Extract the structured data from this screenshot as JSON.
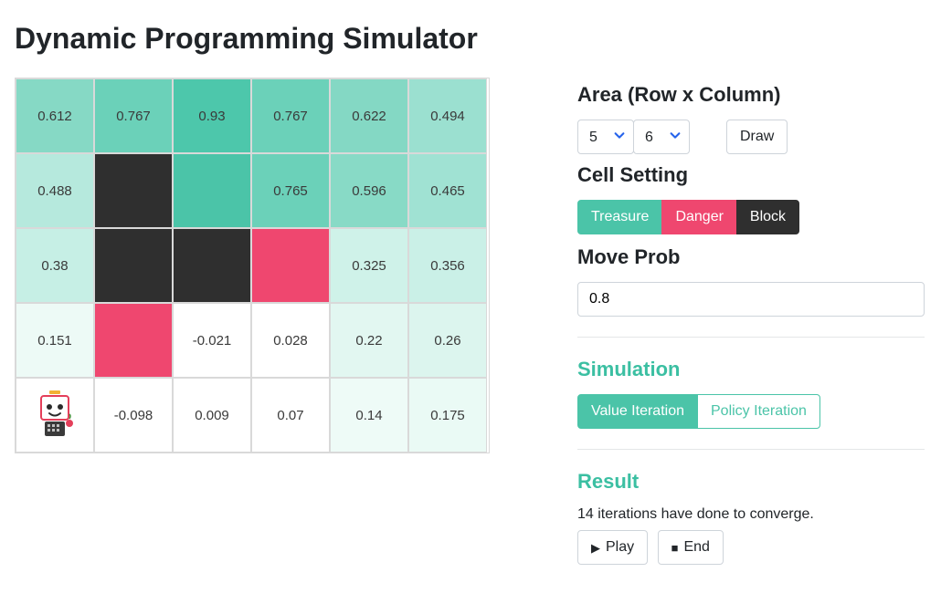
{
  "title": "Dynamic Programming Simulator",
  "grid": {
    "rows": 5,
    "cols": 6,
    "cells": [
      [
        {
          "text": "0.612",
          "bg": "#86d9c5"
        },
        {
          "text": "0.767",
          "bg": "#6bd1b9"
        },
        {
          "text": "0.93",
          "bg": "#4dc7ab"
        },
        {
          "text": "0.767",
          "bg": "#6bd1b9"
        },
        {
          "text": "0.622",
          "bg": "#84d8c4"
        },
        {
          "text": "0.494",
          "bg": "#9be0d0"
        }
      ],
      [
        {
          "text": "0.488",
          "bg": "#b6e9dd"
        },
        {
          "text": "",
          "bg": "#2f2f2f"
        },
        {
          "text": "",
          "bg": "#4bc4a8"
        },
        {
          "text": "0.765",
          "bg": "#6bd1b9"
        },
        {
          "text": "0.596",
          "bg": "#88dac6"
        },
        {
          "text": "0.465",
          "bg": "#a0e2d3"
        }
      ],
      [
        {
          "text": "0.38",
          "bg": "#c6efe5"
        },
        {
          "text": "",
          "bg": "#2f2f2f"
        },
        {
          "text": "",
          "bg": "#2f2f2f"
        },
        {
          "text": "",
          "bg": "#ef476f"
        },
        {
          "text": "0.325",
          "bg": "#cff2e9"
        },
        {
          "text": "0.356",
          "bg": "#caf0e7"
        }
      ],
      [
        {
          "text": "0.151",
          "bg": "#edfaf6"
        },
        {
          "text": "",
          "bg": "#ef476f"
        },
        {
          "text": "-0.021",
          "bg": "#ffffff"
        },
        {
          "text": "0.028",
          "bg": "#ffffff"
        },
        {
          "text": "0.22",
          "bg": "#e2f7f1"
        },
        {
          "text": "0.26",
          "bg": "#dcf5ee"
        }
      ],
      [
        {
          "text": "",
          "bg": "#ffffff",
          "robot": true
        },
        {
          "text": "-0.098",
          "bg": "#ffffff"
        },
        {
          "text": "0.009",
          "bg": "#ffffff"
        },
        {
          "text": "0.07",
          "bg": "#ffffff"
        },
        {
          "text": "0.14",
          "bg": "#eefbf7"
        },
        {
          "text": "0.175",
          "bg": "#eafaf5"
        }
      ]
    ]
  },
  "panel": {
    "area_title": "Area (Row x Column)",
    "row_value": "5",
    "col_value": "6",
    "draw_label": "Draw",
    "cell_setting_title": "Cell Setting",
    "treasure_label": "Treasure",
    "danger_label": "Danger",
    "block_label": "Block",
    "move_prob_title": "Move Prob",
    "move_prob_value": "0.8",
    "simulation_title": "Simulation",
    "value_iteration_label": "Value Iteration",
    "policy_iteration_label": "Policy Iteration",
    "result_title": "Result",
    "result_text": "14 iterations have done to converge.",
    "play_label": "Play",
    "end_label": "End"
  }
}
